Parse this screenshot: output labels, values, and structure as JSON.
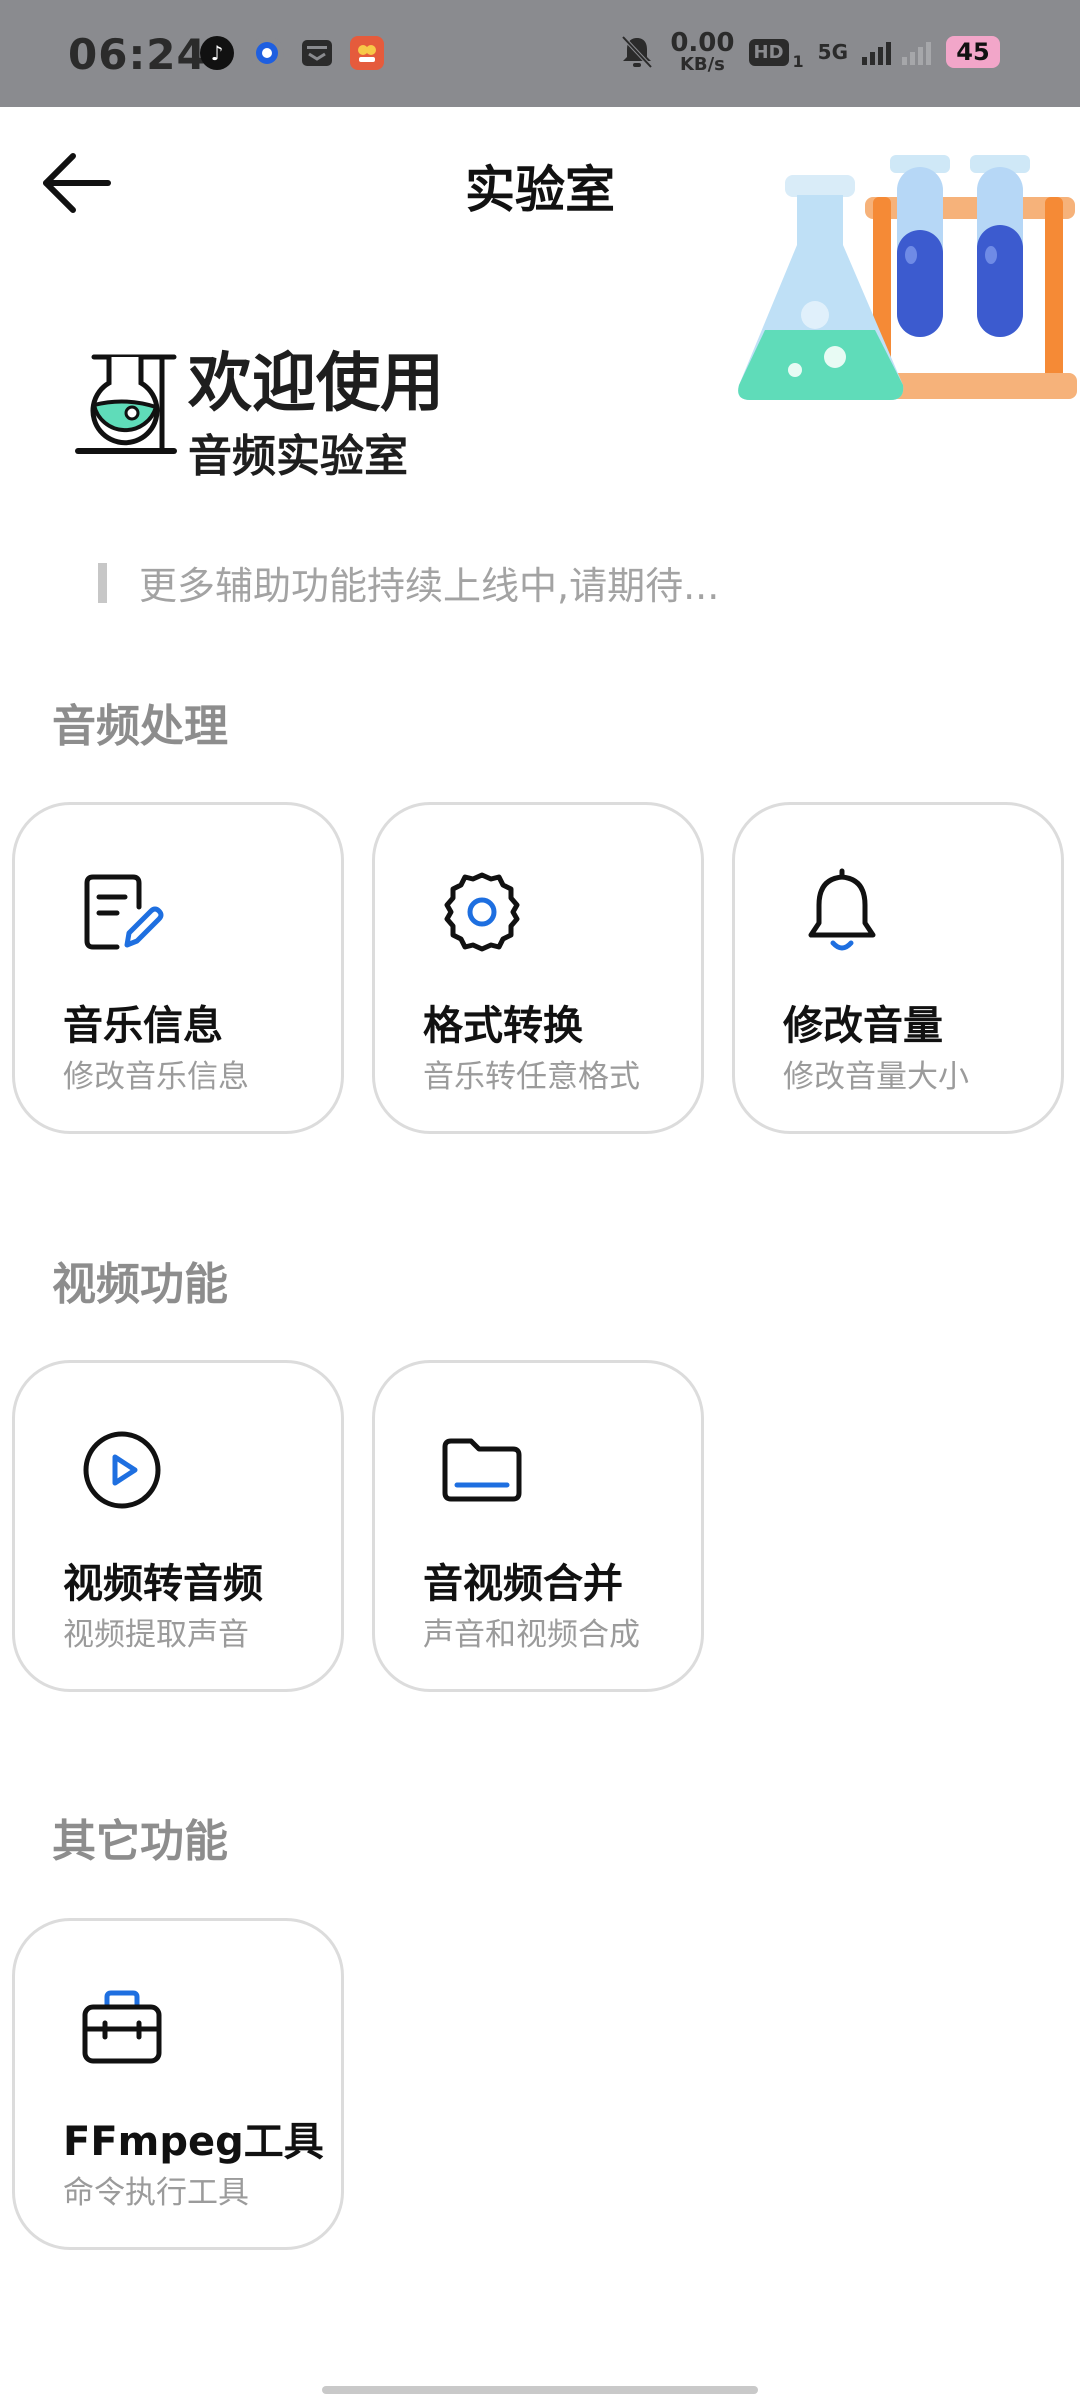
{
  "status_bar": {
    "time": "06:24",
    "net_speed_value": "0.00",
    "net_speed_unit": "KB/s",
    "hd_label": "HD",
    "hd_sub": "1",
    "network": "5G",
    "battery": "45",
    "icons": [
      "music-app-icon",
      "browser-icon",
      "mail-icon",
      "shop-app-icon",
      "mute-bell-icon",
      "signal-icon"
    ]
  },
  "header": {
    "title": "实验室"
  },
  "welcome": {
    "line1": "欢迎使用",
    "line2": "音频实验室"
  },
  "notice": "更多辅助功能持续上线中,请期待...",
  "sections": [
    {
      "title": "音频处理",
      "items": [
        {
          "title": "音乐信息",
          "subtitle": "修改音乐信息",
          "icon": "edit-note-icon"
        },
        {
          "title": "格式转换",
          "subtitle": "音乐转任意格式",
          "icon": "gear-icon"
        },
        {
          "title": "修改音量",
          "subtitle": "修改音量大小",
          "icon": "bell-icon"
        }
      ]
    },
    {
      "title": "视频功能",
      "items": [
        {
          "title": "视频转音频",
          "subtitle": "视频提取声音",
          "icon": "play-circle-icon"
        },
        {
          "title": "音视频合并",
          "subtitle": "声音和视频合成",
          "icon": "folder-icon"
        }
      ]
    },
    {
      "title": "其它功能",
      "items": [
        {
          "title": "FFmpeg工具",
          "subtitle": "命令执行工具",
          "icon": "toolbox-icon"
        }
      ]
    }
  ],
  "colors": {
    "accent": "#1e6fe0",
    "status_bar": "#8a8b8f",
    "section_title": "#8d8d8d"
  }
}
